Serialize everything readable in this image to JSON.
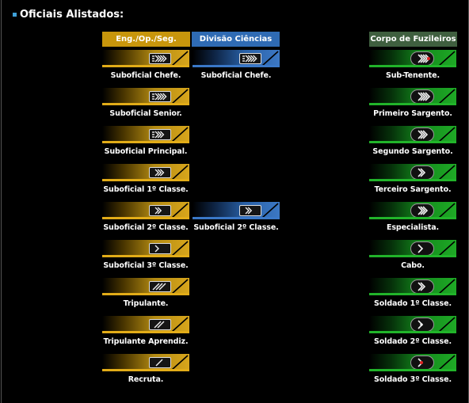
{
  "page": {
    "title": "Oficiais Alistados:"
  },
  "columns": [
    {
      "label": "Eng./Op./Seg.",
      "color": "#c8960c"
    },
    {
      "label": "Divisão Ciências",
      "color": "#2f6bb4"
    },
    {
      "label": "Corpo de Fuzileiros",
      "color": "#3f5f3f"
    }
  ],
  "eng_ranks": [
    {
      "label": "Suboficial Chefe.",
      "icon": "chevron-4-bars-insignia-icon"
    },
    {
      "label": "Suboficial Senior.",
      "icon": "chevron-4-bars-insignia-icon"
    },
    {
      "label": "Suboficial Principal.",
      "icon": "chevron-3-bars-insignia-icon"
    },
    {
      "label": "Suboficial 1º Classe.",
      "icon": "chevron-3-insignia-icon"
    },
    {
      "label": "Suboficial 2º Classe.",
      "icon": "chevron-2-insignia-icon"
    },
    {
      "label": "Suboficial 3º Classe.",
      "icon": "chevron-1-insignia-icon"
    },
    {
      "label": "Tripulante.",
      "icon": "slash-3-insignia-icon"
    },
    {
      "label": "Tripulante Aprendiz.",
      "icon": "slash-2-insignia-icon"
    },
    {
      "label": "Recruta.",
      "icon": "slash-1-insignia-icon"
    }
  ],
  "sci_ranks": [
    {
      "label": "Suboficial Chefe.",
      "icon": "chevron-4-bars-insignia-icon"
    },
    {
      "label": "Suboficial 2º Classe.",
      "icon": "chevron-2-insignia-icon"
    }
  ],
  "marine_ranks": [
    {
      "label": "Sub-Tenente.",
      "icon": "marine-chevron-4-red-icon"
    },
    {
      "label": "Primeiro Sargento.",
      "icon": "marine-chevron-4-icon"
    },
    {
      "label": "Segundo Sargento.",
      "icon": "marine-chevron-3-icon"
    },
    {
      "label": "Terceiro Sargento.",
      "icon": "marine-chevron-2-icon"
    },
    {
      "label": "Especialista.",
      "icon": "marine-chevron-3-open-icon"
    },
    {
      "label": "Cabo.",
      "icon": "marine-chevron-1-icon"
    },
    {
      "label": "Soldado 1º Classe.",
      "icon": "marine-chevron-2-open-icon"
    },
    {
      "label": "Soldado 2º Classe.",
      "icon": "marine-chevron-1-dot-icon"
    },
    {
      "label": "Soldado 3º Classe.",
      "icon": "marine-chevron-1-red-icon"
    }
  ]
}
